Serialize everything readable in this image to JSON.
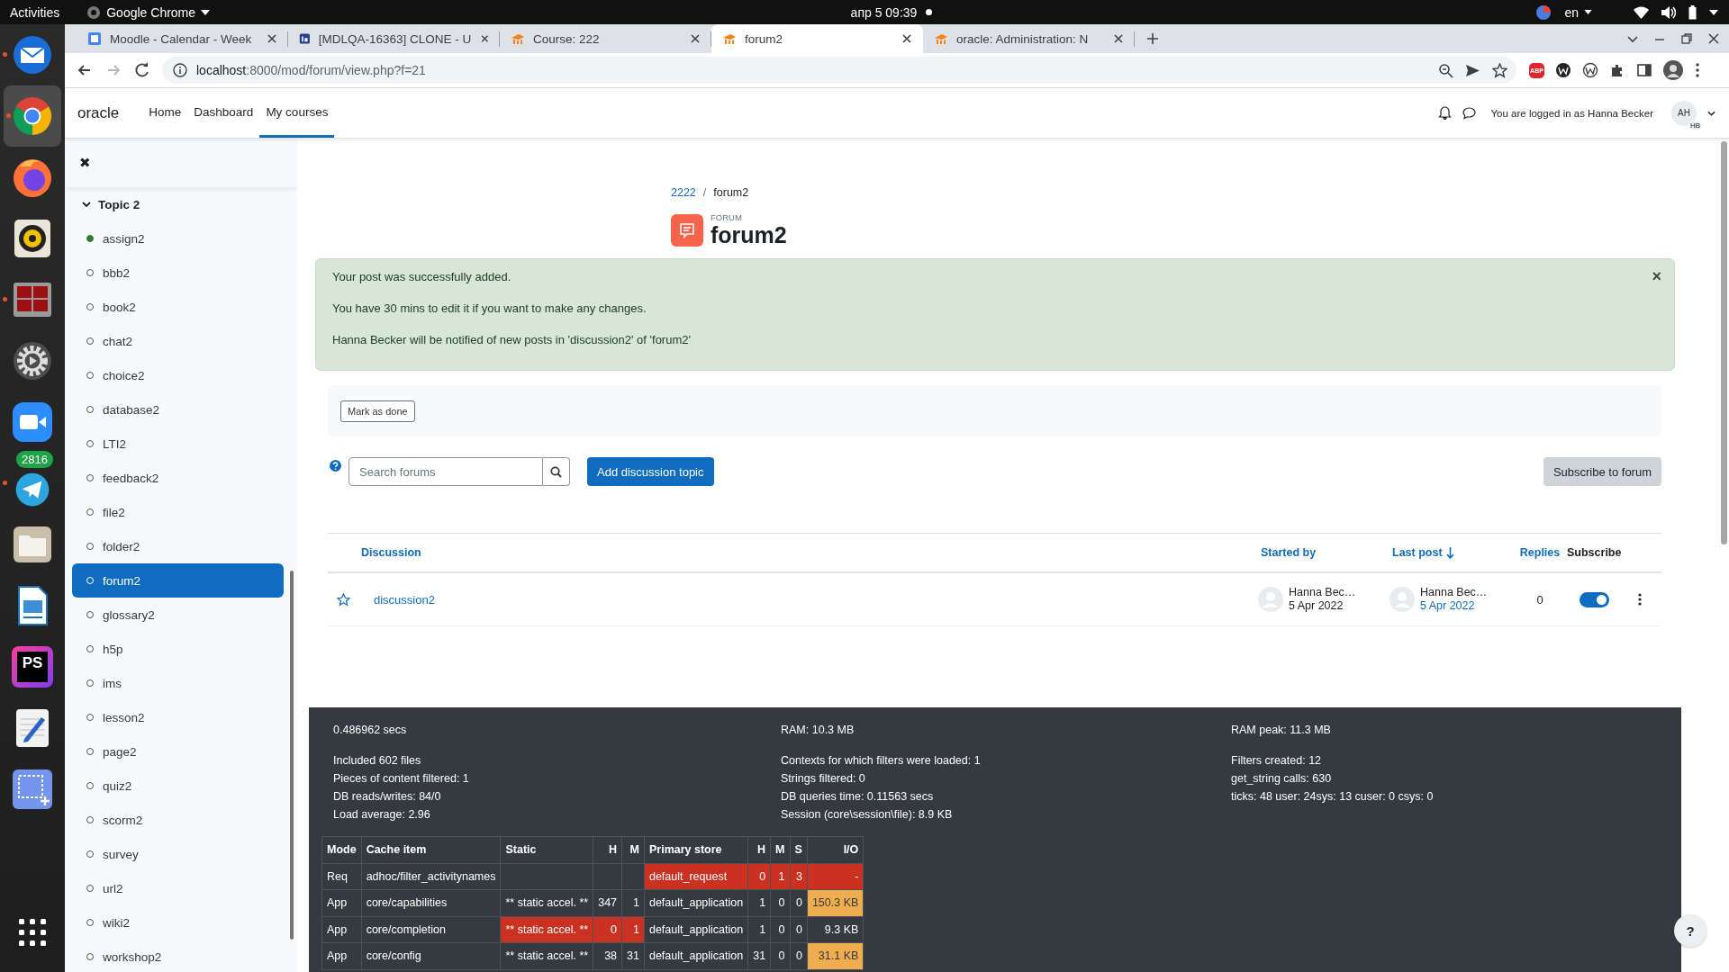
{
  "os_bar": {
    "activities": "Activities",
    "app": "Google Chrome",
    "clock": "апр 5  09:39",
    "language": "en"
  },
  "dock": [
    {
      "kind": "mail",
      "running": true,
      "selected": false
    },
    {
      "kind": "chrome",
      "running": true,
      "selected": true
    },
    {
      "kind": "firefox",
      "running": false,
      "selected": false
    },
    {
      "kind": "music",
      "running": false,
      "selected": false
    },
    {
      "kind": "terminal",
      "running": true,
      "selected": false
    },
    {
      "kind": "settings",
      "running": false,
      "selected": false
    },
    {
      "kind": "video",
      "running": false,
      "selected": false
    },
    {
      "kind": "telegram",
      "running": true,
      "selected": false,
      "badge": "2816"
    },
    {
      "kind": "files",
      "running": false,
      "selected": false
    },
    {
      "kind": "writer",
      "running": false,
      "selected": false
    },
    {
      "kind": "ide",
      "running": false,
      "selected": false,
      "label": "PS"
    },
    {
      "kind": "editor",
      "running": false,
      "selected": false
    },
    {
      "kind": "screenshot",
      "running": false,
      "selected": false
    },
    {
      "kind": "apps",
      "running": false,
      "selected": false
    }
  ],
  "browser": {
    "tabs": [
      {
        "title": "Moodle - Calendar - Week",
        "kind": "calendar",
        "selected": false
      },
      {
        "title": "[MDLQA-16363] CLONE - U",
        "kind": "tracker",
        "selected": false
      },
      {
        "title": "Course: 222",
        "kind": "moodle",
        "selected": false
      },
      {
        "title": "forum2",
        "kind": "moodle",
        "selected": true
      },
      {
        "title": "oracle: Administration: N",
        "kind": "moodle",
        "selected": false
      }
    ],
    "url_host": "localhost",
    "url_rest": ":8000/mod/forum/view.php?f=21",
    "extension_label": "ABP"
  },
  "site": {
    "brand": "oracle",
    "nav": [
      {
        "label": "Home",
        "selected": false
      },
      {
        "label": "Dashboard",
        "selected": false
      },
      {
        "label": "My courses",
        "selected": true
      }
    ],
    "login_text": "You are logged in as Hanna Becker",
    "avatar_initials": "AH",
    "avatar_badge": "HB"
  },
  "course_index": {
    "close": "✖",
    "section": {
      "title": "Topic 2",
      "expanded": true,
      "items": [
        {
          "label": "assign2",
          "completed": true,
          "selected": false
        },
        {
          "label": "bbb2",
          "completed": false,
          "selected": false
        },
        {
          "label": "book2",
          "completed": false,
          "selected": false
        },
        {
          "label": "chat2",
          "completed": false,
          "selected": false
        },
        {
          "label": "choice2",
          "completed": false,
          "selected": false
        },
        {
          "label": "database2",
          "completed": false,
          "selected": false
        },
        {
          "label": "LTI2",
          "completed": false,
          "selected": false
        },
        {
          "label": "feedback2",
          "completed": false,
          "selected": false
        },
        {
          "label": "file2",
          "completed": false,
          "selected": false
        },
        {
          "label": "folder2",
          "completed": false,
          "selected": false
        },
        {
          "label": "forum2",
          "completed": false,
          "selected": true
        },
        {
          "label": "glossary2",
          "completed": false,
          "selected": false
        },
        {
          "label": "h5p",
          "completed": false,
          "selected": false
        },
        {
          "label": "ims",
          "completed": false,
          "selected": false
        },
        {
          "label": "lesson2",
          "completed": false,
          "selected": false
        },
        {
          "label": "page2",
          "completed": false,
          "selected": false
        },
        {
          "label": "quiz2",
          "completed": false,
          "selected": false
        },
        {
          "label": "scorm2",
          "completed": false,
          "selected": false
        },
        {
          "label": "survey",
          "completed": false,
          "selected": false
        },
        {
          "label": "url2",
          "completed": false,
          "selected": false
        },
        {
          "label": "wiki2",
          "completed": false,
          "selected": false
        },
        {
          "label": "workshop2",
          "completed": false,
          "selected": false
        }
      ]
    }
  },
  "forum": {
    "breadcrumb": [
      "2222",
      "forum2"
    ],
    "breadcrumb_separator": "/",
    "module_label": "FORUM",
    "title": "forum2",
    "alert": {
      "messages": [
        "Your post was successfully added.",
        "You have 30 mins to edit it if you want to make any changes.",
        "Hanna Becker will be notified of new posts in 'discussion2' of 'forum2'"
      ],
      "close": "×"
    },
    "mark_done": "Mark as done",
    "search_placeholder": "Search forums",
    "add_button": "Add discussion topic",
    "subscribe_button": "Subscribe to forum",
    "columns": [
      {
        "label": "Discussion",
        "sortable": true,
        "sorted": false
      },
      {
        "label": "Started by",
        "sortable": true,
        "sorted": false
      },
      {
        "label": "Last post",
        "sortable": true,
        "sorted": true
      },
      {
        "label": "Replies",
        "sortable": true,
        "sorted": false
      },
      {
        "label": "Subscribe",
        "sortable": false,
        "sorted": false
      }
    ],
    "rows": [
      {
        "starred": false,
        "title": "discussion2",
        "started_name": "Hanna Bec…",
        "started_date": "5 Apr 2022",
        "last_name": "Hanna Bec…",
        "last_date": "5 Apr 2022",
        "replies": "0",
        "subscribed": true
      }
    ]
  },
  "performance": {
    "columns": [
      {
        "lead": "0.486962 secs",
        "lines": [
          "Included 602 files",
          "Pieces of content filtered: 1",
          "DB reads/writes: 84/0",
          "Load average: 2.96"
        ]
      },
      {
        "lead": "RAM: 10.3 MB",
        "lines": [
          "Contexts for which filters were loaded: 1",
          "Strings filtered: 0",
          "DB queries time: 0.11563 secs",
          "Session (core\\session\\file): 8.9 KB"
        ]
      },
      {
        "lead": "RAM peak: 11.3 MB",
        "lines": [
          "Filters created: 12",
          "get_string calls: 630",
          "ticks: 48 user: 24sys: 13 cuser: 0 csys: 0"
        ]
      }
    ],
    "cache_columns": [
      "Mode",
      "Cache item",
      "Static",
      "H",
      "M",
      "Primary store",
      "H",
      "M",
      "S",
      "I/O"
    ],
    "cache_rows": [
      {
        "cells": [
          {
            "text": "Req",
            "kind": "plain"
          },
          {
            "text": "adhoc/filter_activitynames",
            "kind": "plain"
          },
          {
            "kind": "plain"
          },
          {
            "kind": "plain"
          },
          {
            "kind": "plain"
          },
          {
            "text": "default_request",
            "kind": "error"
          },
          {
            "text": "0",
            "kind": "error"
          },
          {
            "text": "1",
            "kind": "error"
          },
          {
            "text": "3",
            "kind": "error"
          },
          {
            "text": "-",
            "kind": "error"
          }
        ]
      },
      {
        "cells": [
          {
            "text": "App",
            "kind": "plain"
          },
          {
            "text": "core/capabilities",
            "kind": "plain"
          },
          {
            "text": "** static accel. **",
            "kind": "plain"
          },
          {
            "text": "347",
            "kind": "plain"
          },
          {
            "text": "1",
            "kind": "plain"
          },
          {
            "text": "default_application",
            "kind": "plain"
          },
          {
            "text": "1",
            "kind": "plain"
          },
          {
            "text": "0",
            "kind": "plain"
          },
          {
            "text": "0",
            "kind": "plain"
          },
          {
            "text": "150.3 KB",
            "kind": "warning"
          }
        ]
      },
      {
        "cells": [
          {
            "text": "App",
            "kind": "plain"
          },
          {
            "text": "core/completion",
            "kind": "plain"
          },
          {
            "text": "** static accel. **",
            "kind": "error"
          },
          {
            "text": "0",
            "kind": "error"
          },
          {
            "text": "1",
            "kind": "error"
          },
          {
            "text": "default_application",
            "kind": "plain"
          },
          {
            "text": "1",
            "kind": "plain"
          },
          {
            "text": "0",
            "kind": "plain"
          },
          {
            "text": "0",
            "kind": "plain"
          },
          {
            "text": "9.3 KB",
            "kind": "plain"
          }
        ]
      },
      {
        "cells": [
          {
            "text": "App",
            "kind": "plain"
          },
          {
            "text": "core/config",
            "kind": "plain"
          },
          {
            "text": "** static accel. **",
            "kind": "plain"
          },
          {
            "text": "38",
            "kind": "plain"
          },
          {
            "text": "31",
            "kind": "plain"
          },
          {
            "text": "default_application",
            "kind": "plain"
          },
          {
            "text": "31",
            "kind": "plain"
          },
          {
            "text": "0",
            "kind": "plain"
          },
          {
            "text": "0",
            "kind": "plain"
          },
          {
            "text": "31.1 KB",
            "kind": "warning"
          }
        ]
      }
    ]
  },
  "help_button": "?"
}
